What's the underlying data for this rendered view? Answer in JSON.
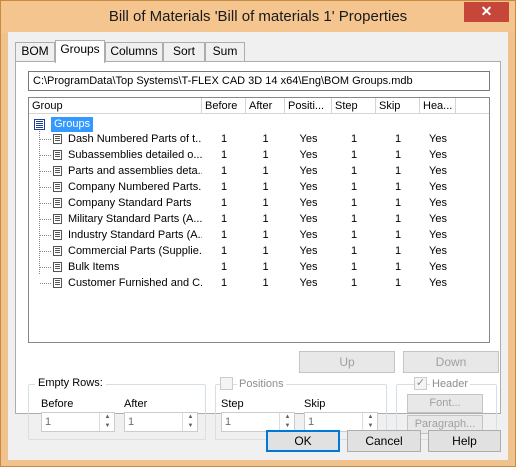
{
  "window": {
    "title": "Bill of Materials 'Bill of materials 1' Properties",
    "close_glyph": "✕"
  },
  "tabs": [
    {
      "label": "BOM"
    },
    {
      "label": "Groups"
    },
    {
      "label": "Columns"
    },
    {
      "label": "Sort"
    },
    {
      "label": "Sum"
    }
  ],
  "path": "C:\\ProgramData\\Top Systems\\T-FLEX CAD 3D 14 x64\\Eng\\BOM Groups.mdb",
  "grid": {
    "columns": [
      "Group",
      "Before",
      "After",
      "Positi...",
      "Step",
      "Skip",
      "Hea..."
    ],
    "root_label": "Groups",
    "rows": [
      {
        "name": "Dash Numbered Parts of t...",
        "before": "1",
        "after": "1",
        "positions": "Yes",
        "step": "1",
        "skip": "1",
        "header": "Yes"
      },
      {
        "name": "Subassemblies detailed o...",
        "before": "1",
        "after": "1",
        "positions": "Yes",
        "step": "1",
        "skip": "1",
        "header": "Yes"
      },
      {
        "name": "Parts and assemblies deta...",
        "before": "1",
        "after": "1",
        "positions": "Yes",
        "step": "1",
        "skip": "1",
        "header": "Yes"
      },
      {
        "name": "Company Numbered Parts...",
        "before": "1",
        "after": "1",
        "positions": "Yes",
        "step": "1",
        "skip": "1",
        "header": "Yes"
      },
      {
        "name": "Company Standard Parts",
        "before": "1",
        "after": "1",
        "positions": "Yes",
        "step": "1",
        "skip": "1",
        "header": "Yes"
      },
      {
        "name": "Military Standard Parts (A...",
        "before": "1",
        "after": "1",
        "positions": "Yes",
        "step": "1",
        "skip": "1",
        "header": "Yes"
      },
      {
        "name": "Industry Standard Parts (A...",
        "before": "1",
        "after": "1",
        "positions": "Yes",
        "step": "1",
        "skip": "1",
        "header": "Yes"
      },
      {
        "name": "Commercial Parts (Supplie...",
        "before": "1",
        "after": "1",
        "positions": "Yes",
        "step": "1",
        "skip": "1",
        "header": "Yes"
      },
      {
        "name": "Bulk Items",
        "before": "1",
        "after": "1",
        "positions": "Yes",
        "step": "1",
        "skip": "1",
        "header": "Yes"
      },
      {
        "name": "Customer Furnished and C...",
        "before": "1",
        "after": "1",
        "positions": "Yes",
        "step": "1",
        "skip": "1",
        "header": "Yes"
      }
    ]
  },
  "buttons": {
    "up": "Up",
    "down": "Down",
    "font": "Font...",
    "paragraph": "Paragraph...",
    "ok": "OK",
    "cancel": "Cancel",
    "help": "Help"
  },
  "empty_rows": {
    "title": "Empty Rows:",
    "before_label": "Before",
    "before_value": "1",
    "after_label": "After",
    "after_value": "1"
  },
  "positions": {
    "title": "Positions",
    "checked": false,
    "step_label": "Step",
    "step_value": "1",
    "skip_label": "Skip",
    "skip_value": "1"
  },
  "header": {
    "title": "Header",
    "checked": true,
    "check_glyph": "✓"
  },
  "colors": {
    "title_bar": "#f4c58f",
    "close_button": "#c7463a",
    "selection": "#3399ff"
  }
}
